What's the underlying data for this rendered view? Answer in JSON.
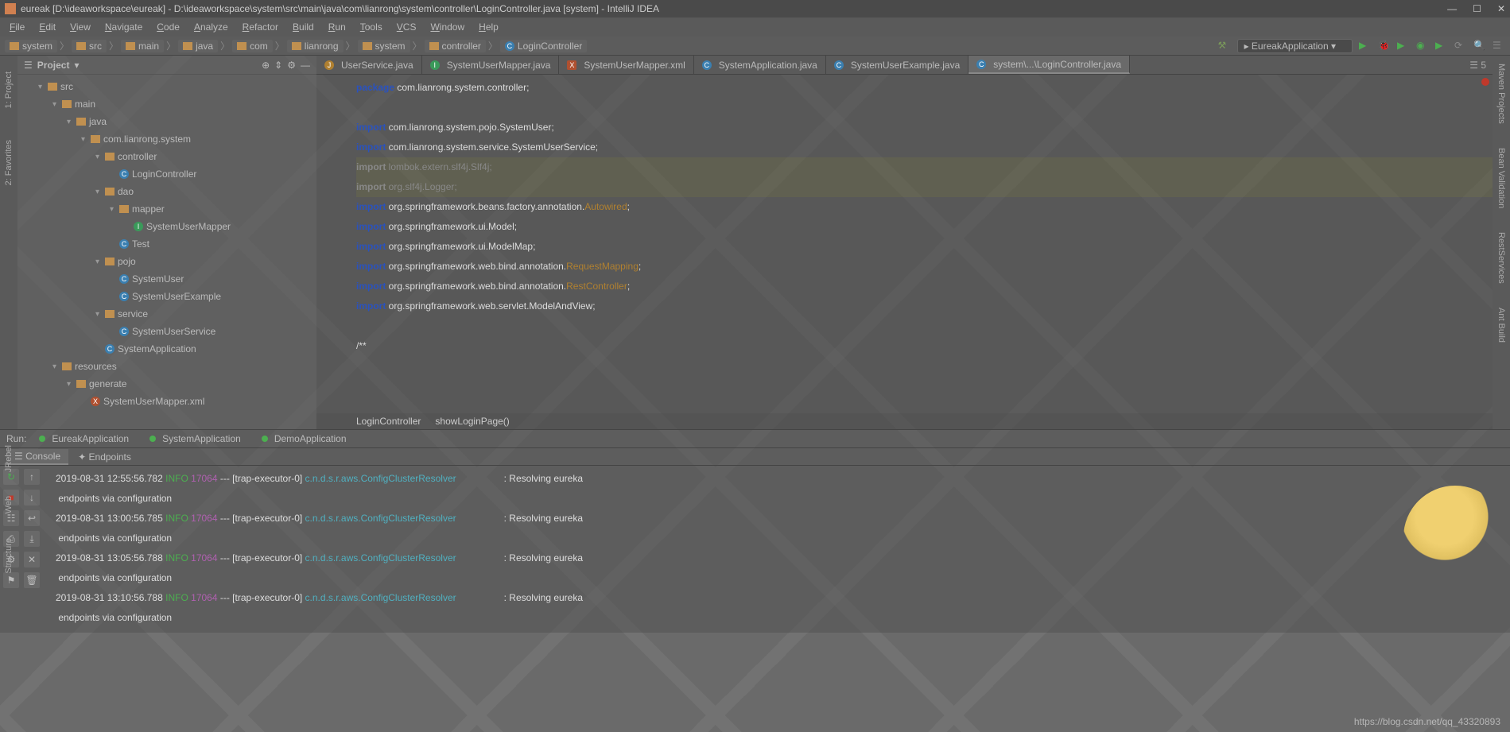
{
  "title": "eureak [D:\\ideaworkspace\\eureak] - D:\\ideaworkspace\\system\\src\\main\\java\\com\\lianrong\\system\\controller\\LoginController.java [system] - IntelliJ IDEA",
  "menu": [
    "File",
    "Edit",
    "View",
    "Navigate",
    "Code",
    "Analyze",
    "Refactor",
    "Build",
    "Run",
    "Tools",
    "VCS",
    "Window",
    "Help"
  ],
  "breadcrumbs": [
    "system",
    "src",
    "main",
    "java",
    "com",
    "lianrong",
    "system",
    "controller",
    "LoginController"
  ],
  "runConfig": "EureakApplication",
  "projectPanel": {
    "title": "Project"
  },
  "tree": [
    {
      "indent": 1,
      "arrow": "▾",
      "icon": "fld",
      "label": "src"
    },
    {
      "indent": 2,
      "arrow": "▾",
      "icon": "fld",
      "label": "main"
    },
    {
      "indent": 3,
      "arrow": "▾",
      "icon": "fld",
      "label": "java"
    },
    {
      "indent": 4,
      "arrow": "▾",
      "icon": "fld",
      "label": "com.lianrong.system"
    },
    {
      "indent": 5,
      "arrow": "▾",
      "icon": "fld",
      "label": "controller"
    },
    {
      "indent": 6,
      "arrow": "",
      "icon": "c",
      "label": "LoginController"
    },
    {
      "indent": 5,
      "arrow": "▾",
      "icon": "fld",
      "label": "dao"
    },
    {
      "indent": 6,
      "arrow": "▾",
      "icon": "fld",
      "label": "mapper"
    },
    {
      "indent": 7,
      "arrow": "",
      "icon": "i",
      "label": "SystemUserMapper"
    },
    {
      "indent": 6,
      "arrow": "",
      "icon": "c",
      "label": "Test"
    },
    {
      "indent": 5,
      "arrow": "▾",
      "icon": "fld",
      "label": "pojo"
    },
    {
      "indent": 6,
      "arrow": "",
      "icon": "c",
      "label": "SystemUser"
    },
    {
      "indent": 6,
      "arrow": "",
      "icon": "c",
      "label": "SystemUserExample"
    },
    {
      "indent": 5,
      "arrow": "▾",
      "icon": "fld",
      "label": "service"
    },
    {
      "indent": 6,
      "arrow": "",
      "icon": "c",
      "label": "SystemUserService"
    },
    {
      "indent": 5,
      "arrow": "",
      "icon": "c",
      "label": "SystemApplication"
    },
    {
      "indent": 2,
      "arrow": "▾",
      "icon": "fld",
      "label": "resources"
    },
    {
      "indent": 3,
      "arrow": "▾",
      "icon": "fld",
      "label": "generate"
    },
    {
      "indent": 4,
      "arrow": "",
      "icon": "x",
      "label": "SystemUserMapper.xml"
    }
  ],
  "tabs": [
    {
      "label": "UserService.java",
      "icon": "j"
    },
    {
      "label": "SystemUserMapper.java",
      "icon": "i"
    },
    {
      "label": "SystemUserMapper.xml",
      "icon": "x"
    },
    {
      "label": "SystemApplication.java",
      "icon": "c"
    },
    {
      "label": "SystemUserExample.java",
      "icon": "c"
    },
    {
      "label": "system\\...\\LoginController.java",
      "icon": "c",
      "active": true
    }
  ],
  "tabCount": "5",
  "code": {
    "l1": {
      "kw": "package",
      "rest": " com.lianrong.system.controller;"
    },
    "l3": {
      "kw": "import",
      "rest": " com.lianrong.system.pojo.SystemUser;"
    },
    "l4": {
      "kw": "import",
      "rest": " com.lianrong.system.service.SystemUserService;"
    },
    "l5": {
      "kw": "import",
      "rest": " lombok.extern.slf4j.Slf4j;"
    },
    "l6": {
      "kw": "import",
      "rest": " org.slf4j.Logger;"
    },
    "l7": {
      "kw": "import",
      "pre": " org.springframework.beans.factory.annotation.",
      "hl": "Autowired",
      "post": ";"
    },
    "l8": {
      "kw": "import",
      "rest": " org.springframework.ui.Model;"
    },
    "l9": {
      "kw": "import",
      "rest": " org.springframework.ui.ModelMap;"
    },
    "l10": {
      "kw": "import",
      "pre": " org.springframework.web.bind.annotation.",
      "hl": "RequestMapping",
      "post": ";"
    },
    "l11": {
      "kw": "import",
      "pre": " org.springframework.web.bind.annotation.",
      "hl": "RestController",
      "post": ";"
    },
    "l12": {
      "kw": "import",
      "rest": " org.springframework.web.servlet.ModelAndView;"
    },
    "l14": "/**"
  },
  "codeCrumbs": [
    "LoginController",
    "showLoginPage()"
  ],
  "runTabs": [
    "EureakApplication",
    "SystemApplication",
    "DemoApplication"
  ],
  "runLabel": "Run:",
  "subTabs": [
    "Console",
    "Endpoints"
  ],
  "log": [
    {
      "ts": "2019-08-31 12:55:56.782",
      "lvl": "INFO",
      "pid": "17064",
      "mid": "--- [trap-executor-0]",
      "cls": "c.n.d.s.r.aws.ConfigClusterResolver",
      "msg": ": Resolving eureka"
    },
    {
      "cont": "endpoints via configuration"
    },
    {
      "ts": "2019-08-31 13:00:56.785",
      "lvl": "INFO",
      "pid": "17064",
      "mid": "--- [trap-executor-0]",
      "cls": "c.n.d.s.r.aws.ConfigClusterResolver",
      "msg": ": Resolving eureka"
    },
    {
      "cont": "endpoints via configuration"
    },
    {
      "ts": "2019-08-31 13:05:56.788",
      "lvl": "INFO",
      "pid": "17064",
      "mid": "--- [trap-executor-0]",
      "cls": "c.n.d.s.r.aws.ConfigClusterResolver",
      "msg": ": Resolving eureka"
    },
    {
      "cont": "endpoints via configuration"
    },
    {
      "ts": "2019-08-31 13:10:56.788",
      "lvl": "INFO",
      "pid": "17064",
      "mid": "--- [trap-executor-0]",
      "cls": "c.n.d.s.r.aws.ConfigClusterResolver",
      "msg": ": Resolving eureka"
    },
    {
      "cont": "endpoints via configuration"
    }
  ],
  "leftTools": [
    "1: Project",
    "2: Favorites"
  ],
  "rightTools": [
    "Maven Projects",
    "Bean Validation",
    "RestServices",
    "Ant Build"
  ],
  "bottomLeftTools": [
    "JRebel",
    "Web",
    "Structure"
  ],
  "watermark": "https://blog.csdn.net/qq_43320893"
}
